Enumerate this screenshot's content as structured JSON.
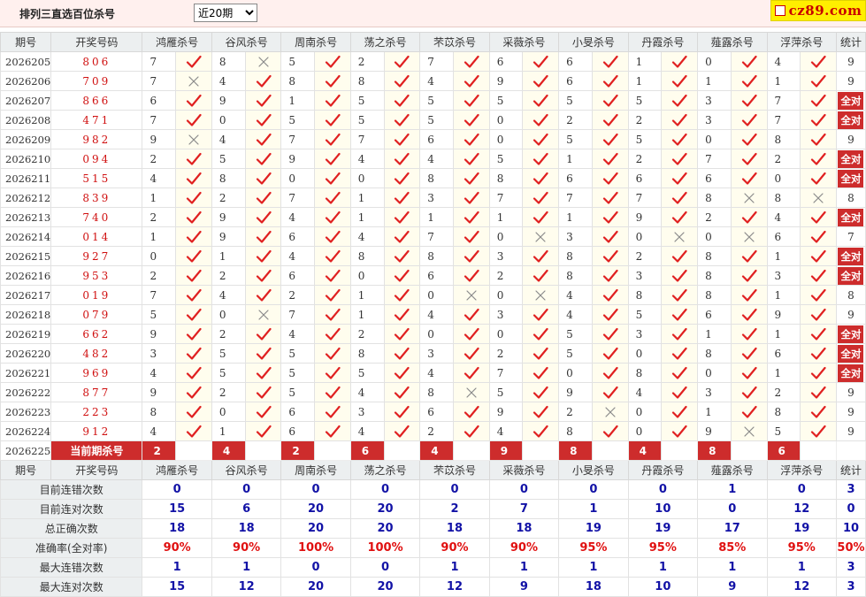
{
  "header": {
    "title": "排列三直选百位杀号",
    "period_select": "近20期",
    "site": "cz89.com"
  },
  "columns": [
    "期号",
    "开奖号码",
    "鸿雁杀号",
    "谷风杀号",
    "周南杀号",
    "荡之杀号",
    "芣苡杀号",
    "采薇杀号",
    "小旻杀号",
    "丹霞杀号",
    "薤露杀号",
    "浮萍杀号",
    "统计"
  ],
  "rows": [
    {
      "qh": "2026205",
      "kj": "806",
      "k": [
        [
          "7",
          1
        ],
        [
          "8",
          0
        ],
        [
          "5",
          1
        ],
        [
          "2",
          1
        ],
        [
          "7",
          1
        ],
        [
          "6",
          1
        ],
        [
          "6",
          1
        ],
        [
          "1",
          1
        ],
        [
          "0",
          1
        ],
        [
          "4",
          1
        ]
      ],
      "stat": "9"
    },
    {
      "qh": "2026206",
      "kj": "709",
      "k": [
        [
          "7",
          0
        ],
        [
          "4",
          1
        ],
        [
          "8",
          1
        ],
        [
          "8",
          1
        ],
        [
          "4",
          1
        ],
        [
          "9",
          1
        ],
        [
          "6",
          1
        ],
        [
          "1",
          1
        ],
        [
          "1",
          1
        ],
        [
          "1",
          1
        ]
      ],
      "stat": "9"
    },
    {
      "qh": "2026207",
      "kj": "866",
      "k": [
        [
          "6",
          1
        ],
        [
          "9",
          1
        ],
        [
          "1",
          1
        ],
        [
          "5",
          1
        ],
        [
          "5",
          1
        ],
        [
          "5",
          1
        ],
        [
          "5",
          1
        ],
        [
          "5",
          1
        ],
        [
          "3",
          1
        ],
        [
          "7",
          1
        ]
      ],
      "stat": "全对"
    },
    {
      "qh": "2026208",
      "kj": "471",
      "k": [
        [
          "7",
          1
        ],
        [
          "0",
          1
        ],
        [
          "5",
          1
        ],
        [
          "5",
          1
        ],
        [
          "5",
          1
        ],
        [
          "0",
          1
        ],
        [
          "2",
          1
        ],
        [
          "2",
          1
        ],
        [
          "3",
          1
        ],
        [
          "7",
          1
        ]
      ],
      "stat": "全对"
    },
    {
      "qh": "2026209",
      "kj": "982",
      "k": [
        [
          "9",
          0
        ],
        [
          "4",
          1
        ],
        [
          "7",
          1
        ],
        [
          "7",
          1
        ],
        [
          "6",
          1
        ],
        [
          "0",
          1
        ],
        [
          "5",
          1
        ],
        [
          "5",
          1
        ],
        [
          "0",
          1
        ],
        [
          "8",
          1
        ]
      ],
      "stat": "9"
    },
    {
      "qh": "2026210",
      "kj": "094",
      "k": [
        [
          "2",
          1
        ],
        [
          "5",
          1
        ],
        [
          "9",
          1
        ],
        [
          "4",
          1
        ],
        [
          "4",
          1
        ],
        [
          "5",
          1
        ],
        [
          "1",
          1
        ],
        [
          "2",
          1
        ],
        [
          "7",
          1
        ],
        [
          "2",
          1
        ]
      ],
      "stat": "全对"
    },
    {
      "qh": "2026211",
      "kj": "515",
      "k": [
        [
          "4",
          1
        ],
        [
          "8",
          1
        ],
        [
          "0",
          1
        ],
        [
          "0",
          1
        ],
        [
          "8",
          1
        ],
        [
          "8",
          1
        ],
        [
          "6",
          1
        ],
        [
          "6",
          1
        ],
        [
          "6",
          1
        ],
        [
          "0",
          1
        ]
      ],
      "stat": "全对"
    },
    {
      "qh": "2026212",
      "kj": "839",
      "k": [
        [
          "1",
          1
        ],
        [
          "2",
          1
        ],
        [
          "7",
          1
        ],
        [
          "1",
          1
        ],
        [
          "3",
          1
        ],
        [
          "7",
          1
        ],
        [
          "7",
          1
        ],
        [
          "7",
          1
        ],
        [
          "8",
          0
        ],
        [
          "8",
          0
        ]
      ],
      "stat": "8"
    },
    {
      "qh": "2026213",
      "kj": "740",
      "k": [
        [
          "2",
          1
        ],
        [
          "9",
          1
        ],
        [
          "4",
          1
        ],
        [
          "1",
          1
        ],
        [
          "1",
          1
        ],
        [
          "1",
          1
        ],
        [
          "1",
          1
        ],
        [
          "9",
          1
        ],
        [
          "2",
          1
        ],
        [
          "4",
          1
        ]
      ],
      "stat": "全对"
    },
    {
      "qh": "2026214",
      "kj": "014",
      "k": [
        [
          "1",
          1
        ],
        [
          "9",
          1
        ],
        [
          "6",
          1
        ],
        [
          "4",
          1
        ],
        [
          "7",
          1
        ],
        [
          "0",
          0
        ],
        [
          "3",
          1
        ],
        [
          "0",
          0
        ],
        [
          "0",
          0
        ],
        [
          "6",
          1
        ]
      ],
      "stat": "7"
    },
    {
      "qh": "2026215",
      "kj": "927",
      "k": [
        [
          "0",
          1
        ],
        [
          "1",
          1
        ],
        [
          "4",
          1
        ],
        [
          "8",
          1
        ],
        [
          "8",
          1
        ],
        [
          "3",
          1
        ],
        [
          "8",
          1
        ],
        [
          "2",
          1
        ],
        [
          "8",
          1
        ],
        [
          "1",
          1
        ]
      ],
      "stat": "全对"
    },
    {
      "qh": "2026216",
      "kj": "953",
      "k": [
        [
          "2",
          1
        ],
        [
          "2",
          1
        ],
        [
          "6",
          1
        ],
        [
          "0",
          1
        ],
        [
          "6",
          1
        ],
        [
          "2",
          1
        ],
        [
          "8",
          1
        ],
        [
          "3",
          1
        ],
        [
          "8",
          1
        ],
        [
          "3",
          1
        ]
      ],
      "stat": "全对"
    },
    {
      "qh": "2026217",
      "kj": "019",
      "k": [
        [
          "7",
          1
        ],
        [
          "4",
          1
        ],
        [
          "2",
          1
        ],
        [
          "1",
          1
        ],
        [
          "0",
          0
        ],
        [
          "0",
          0
        ],
        [
          "4",
          1
        ],
        [
          "8",
          1
        ],
        [
          "8",
          1
        ],
        [
          "1",
          1
        ]
      ],
      "stat": "8"
    },
    {
      "qh": "2026218",
      "kj": "079",
      "k": [
        [
          "5",
          1
        ],
        [
          "0",
          0
        ],
        [
          "7",
          1
        ],
        [
          "1",
          1
        ],
        [
          "4",
          1
        ],
        [
          "3",
          1
        ],
        [
          "4",
          1
        ],
        [
          "5",
          1
        ],
        [
          "6",
          1
        ],
        [
          "9",
          1
        ]
      ],
      "stat": "9"
    },
    {
      "qh": "2026219",
      "kj": "662",
      "k": [
        [
          "9",
          1
        ],
        [
          "2",
          1
        ],
        [
          "4",
          1
        ],
        [
          "2",
          1
        ],
        [
          "0",
          1
        ],
        [
          "0",
          1
        ],
        [
          "5",
          1
        ],
        [
          "3",
          1
        ],
        [
          "1",
          1
        ],
        [
          "1",
          1
        ]
      ],
      "stat": "全对"
    },
    {
      "qh": "2026220",
      "kj": "482",
      "k": [
        [
          "3",
          1
        ],
        [
          "5",
          1
        ],
        [
          "5",
          1
        ],
        [
          "8",
          1
        ],
        [
          "3",
          1
        ],
        [
          "2",
          1
        ],
        [
          "5",
          1
        ],
        [
          "0",
          1
        ],
        [
          "8",
          1
        ],
        [
          "6",
          1
        ]
      ],
      "stat": "全对"
    },
    {
      "qh": "2026221",
      "kj": "969",
      "k": [
        [
          "4",
          1
        ],
        [
          "5",
          1
        ],
        [
          "5",
          1
        ],
        [
          "5",
          1
        ],
        [
          "4",
          1
        ],
        [
          "7",
          1
        ],
        [
          "0",
          1
        ],
        [
          "8",
          1
        ],
        [
          "0",
          1
        ],
        [
          "1",
          1
        ]
      ],
      "stat": "全对"
    },
    {
      "qh": "2026222",
      "kj": "877",
      "k": [
        [
          "9",
          1
        ],
        [
          "2",
          1
        ],
        [
          "5",
          1
        ],
        [
          "4",
          1
        ],
        [
          "8",
          0
        ],
        [
          "5",
          1
        ],
        [
          "9",
          1
        ],
        [
          "4",
          1
        ],
        [
          "3",
          1
        ],
        [
          "2",
          1
        ]
      ],
      "stat": "9"
    },
    {
      "qh": "2026223",
      "kj": "223",
      "k": [
        [
          "8",
          1
        ],
        [
          "0",
          1
        ],
        [
          "6",
          1
        ],
        [
          "3",
          1
        ],
        [
          "6",
          1
        ],
        [
          "9",
          1
        ],
        [
          "2",
          0
        ],
        [
          "0",
          1
        ],
        [
          "1",
          1
        ],
        [
          "8",
          1
        ]
      ],
      "stat": "9"
    },
    {
      "qh": "2026224",
      "kj": "912",
      "k": [
        [
          "4",
          1
        ],
        [
          "1",
          1
        ],
        [
          "6",
          1
        ],
        [
          "4",
          1
        ],
        [
          "2",
          1
        ],
        [
          "4",
          1
        ],
        [
          "8",
          1
        ],
        [
          "0",
          1
        ],
        [
          "9",
          0
        ],
        [
          "5",
          1
        ]
      ],
      "stat": "9"
    }
  ],
  "current": {
    "qh": "2026225",
    "label": "当前期杀号",
    "values": [
      "2",
      "4",
      "2",
      "6",
      "4",
      "9",
      "8",
      "4",
      "8",
      "6"
    ]
  },
  "stats": [
    {
      "label": "目前连错次数",
      "values": [
        "0",
        "0",
        "0",
        "0",
        "0",
        "0",
        "0",
        "0",
        "1",
        "0",
        "3"
      ]
    },
    {
      "label": "目前连对次数",
      "values": [
        "15",
        "6",
        "20",
        "20",
        "2",
        "7",
        "1",
        "10",
        "0",
        "12",
        "0"
      ]
    },
    {
      "label": "总正确次数",
      "values": [
        "18",
        "18",
        "20",
        "20",
        "18",
        "18",
        "19",
        "19",
        "17",
        "19",
        "10"
      ]
    },
    {
      "label": "准确率(全对率)",
      "values": [
        "90%",
        "90%",
        "100%",
        "100%",
        "90%",
        "90%",
        "95%",
        "95%",
        "85%",
        "95%",
        "50%"
      ]
    },
    {
      "label": "最大连错次数",
      "values": [
        "1",
        "1",
        "0",
        "0",
        "1",
        "1",
        "1",
        "1",
        "1",
        "1",
        "3"
      ]
    },
    {
      "label": "最大连对次数",
      "values": [
        "15",
        "12",
        "20",
        "20",
        "12",
        "9",
        "18",
        "10",
        "9",
        "12",
        "3"
      ]
    }
  ]
}
